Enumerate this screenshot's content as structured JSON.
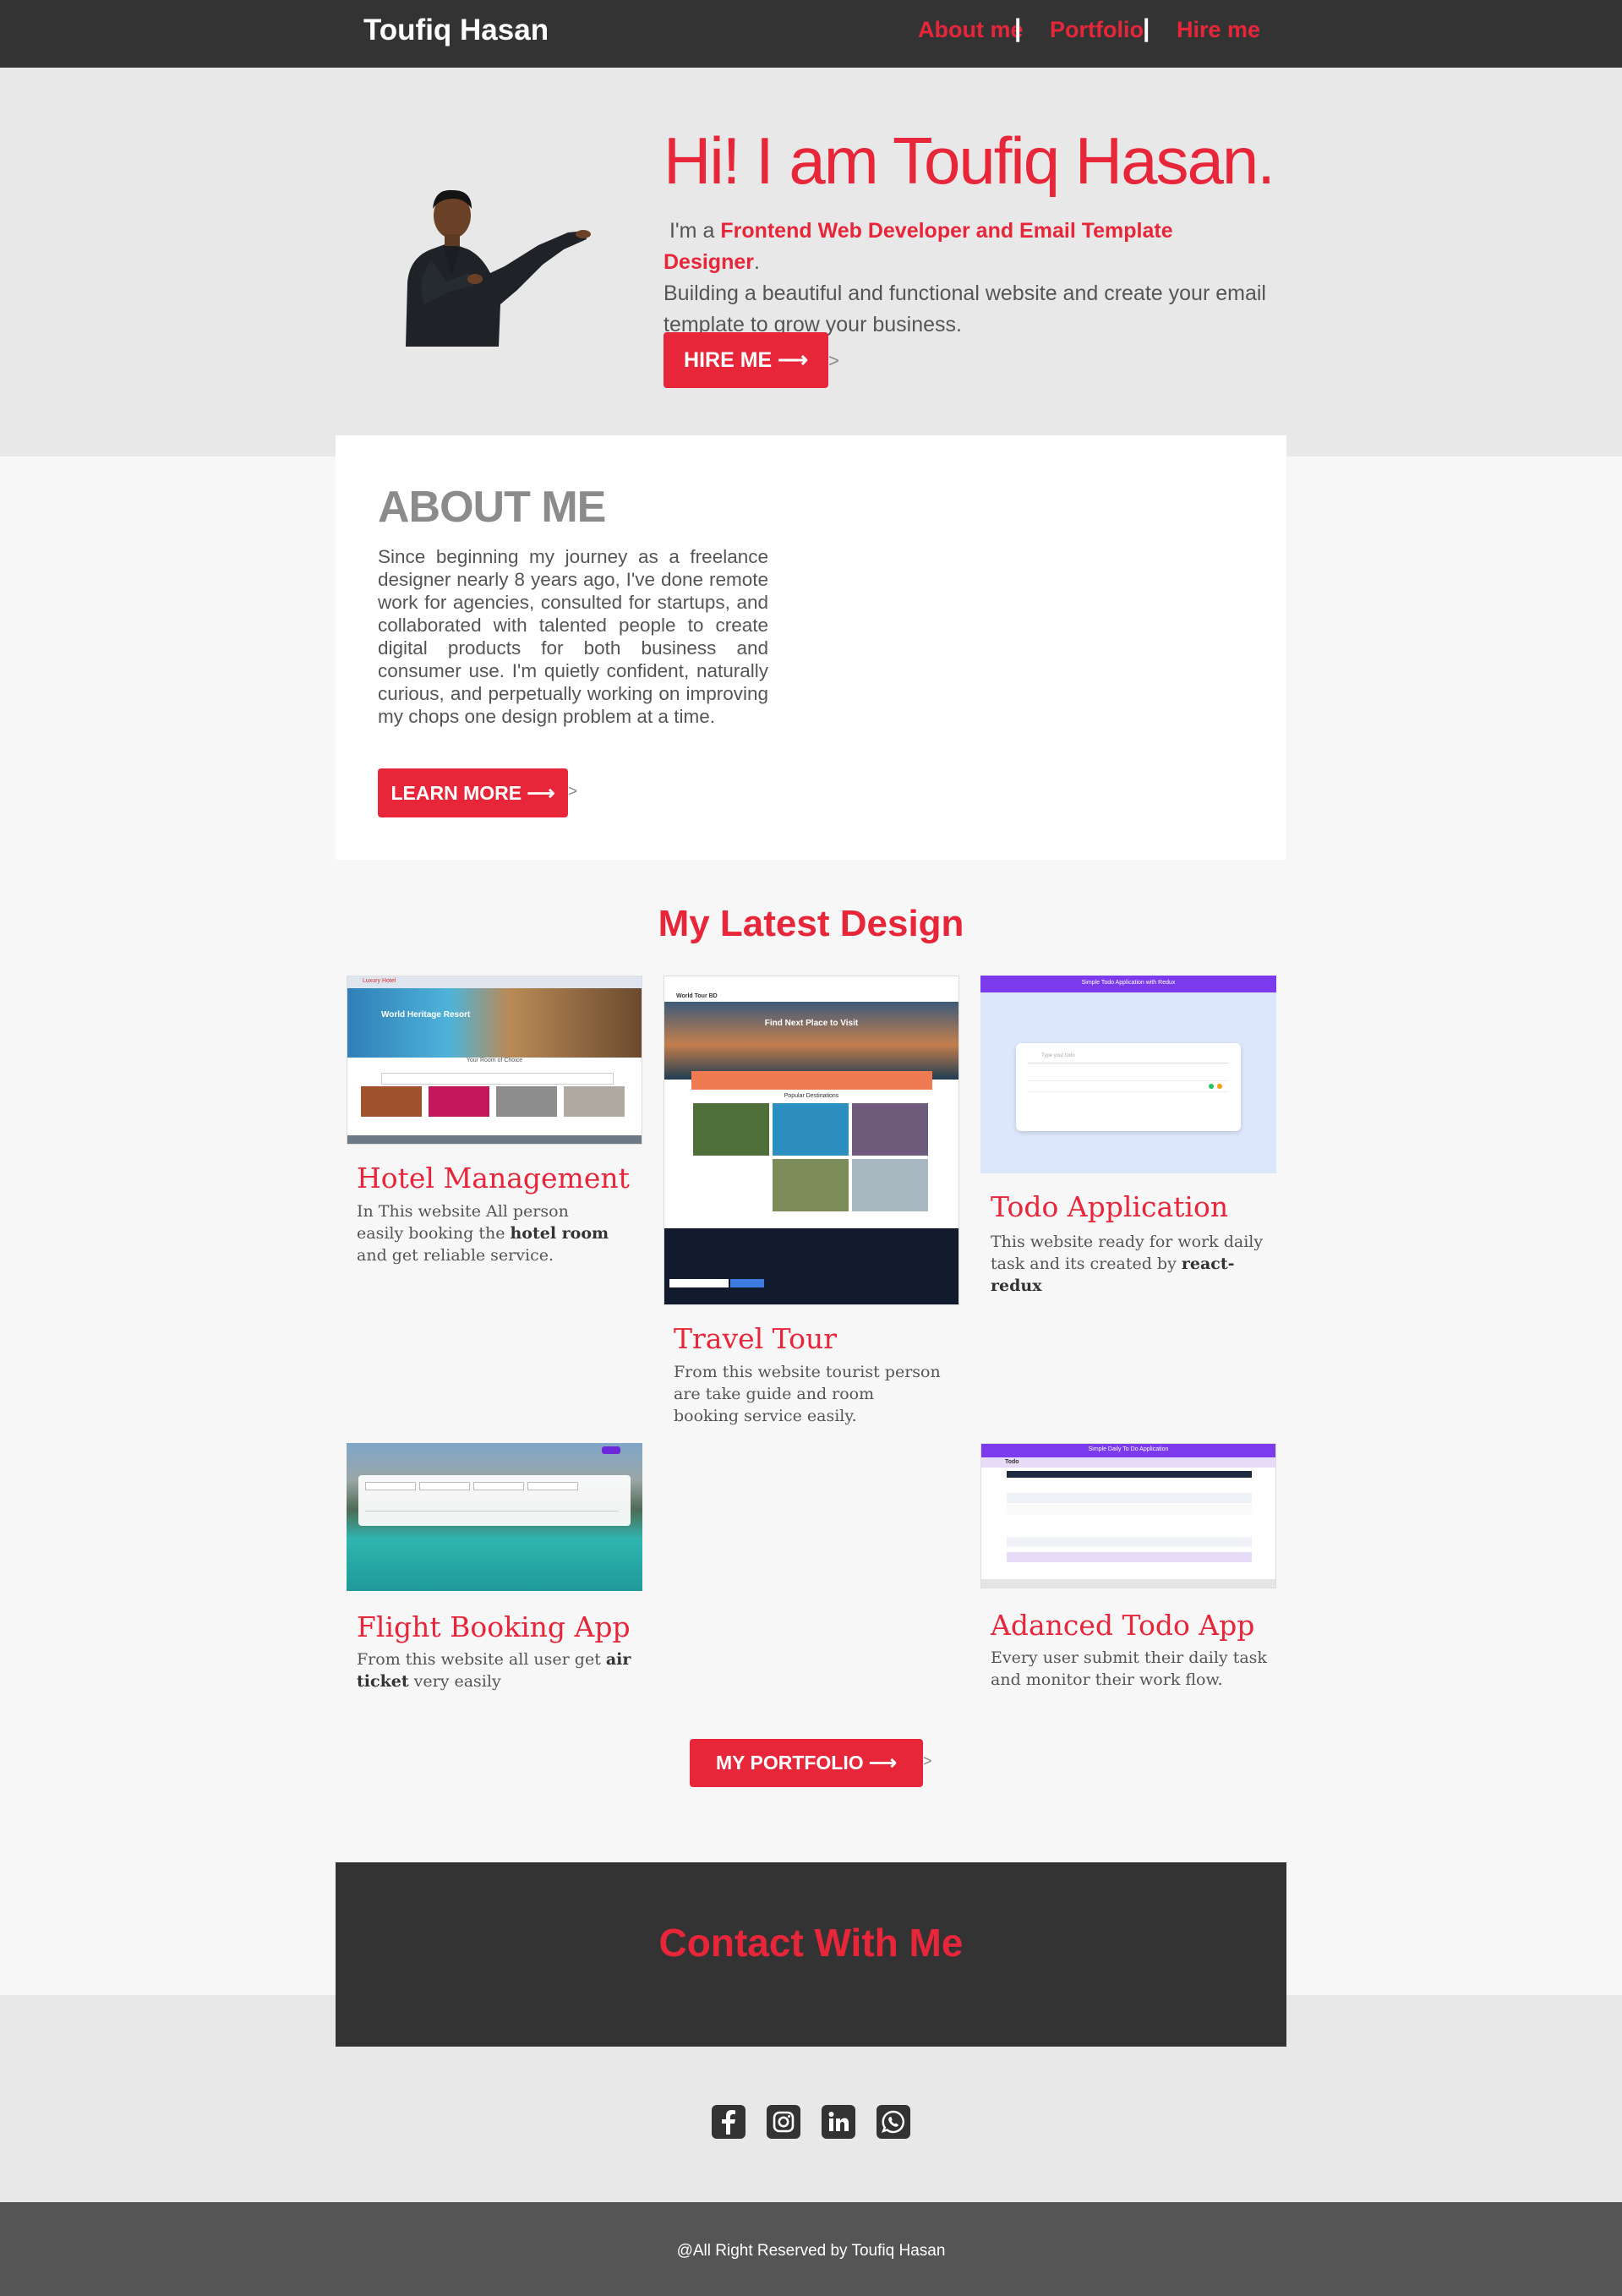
{
  "nav": {
    "brand": "Toufiq Hasan",
    "links": [
      "About me",
      "Portfolio",
      "Hire me"
    ],
    "separator": "|"
  },
  "hero": {
    "title": "Hi! I am Toufiq Hasan.",
    "intro_prefix": "I'm a",
    "intro_role": "Frontend  Web Developer and Email Template Designer",
    "intro_suffix": ".",
    "intro_rest": "Building a beautiful and functional website and create your email template to grow your business.",
    "button": "HIRE ME ⟶",
    "button_tail": ">"
  },
  "about": {
    "title": "ABOUT ME",
    "text": "Since beginning my journey as a freelance designer nearly 8 years ago, I've done remote work for agencies, consulted for startups, and collaborated with talented people to create digital products for both business and consumer use. I'm quietly confident, naturally curious, and perpetually working on improving my chops one design problem at a time.",
    "button": "LEARN MORE ⟶",
    "button_tail": ">"
  },
  "portfolio": {
    "title": "My Latest Design",
    "projects": [
      {
        "title": "Hotel Management",
        "desc_1": "In This website All person easily booking the ",
        "desc_bold": "hotel room",
        "desc_2": " and get reliable service.",
        "shot": {
          "brand": "Luxury Hotel",
          "hero": "World Heritage Resort",
          "section": "Your Room of Choice"
        }
      },
      {
        "title": "Travel Tour",
        "desc_1": "From this website tourist person are take guide and room booking service easily.",
        "desc_bold": "",
        "desc_2": "",
        "shot": {
          "brand": "World Tour BD",
          "hero": "Find Next Place to Visit",
          "section": "Popular Destinations"
        }
      },
      {
        "title": "Todo Application",
        "desc_1": "This website ready for work daily task and its created by ",
        "desc_bold": "react-redux",
        "desc_2": "",
        "shot": {
          "header": "Simple Todo Application with Redux",
          "placeholder": "Type your todo"
        }
      },
      {
        "title": "Flight Booking App",
        "desc_1": "From this website all user get ",
        "desc_bold": "air ticket",
        "desc_2": " very easily",
        "shot": {}
      },
      {
        "title": "Adanced Todo App",
        "desc_1": "Every user submit their daily task  and monitor their work flow.",
        "desc_bold": "",
        "desc_2": "",
        "shot": {
          "header": "Simple Daily To Do Application",
          "brand": "Todo"
        }
      }
    ],
    "button": "MY PORTFOLIO ⟶",
    "button_tail": ">"
  },
  "contact": {
    "title": "Contact With Me"
  },
  "social": {
    "icons": [
      "facebook-icon",
      "instagram-icon",
      "linkedin-icon",
      "whatsapp-icon"
    ]
  },
  "footer": {
    "text": "@All Right Reserved  by Toufiq Hasan"
  },
  "colors": {
    "accent": "#e8263a",
    "dark": "#333333",
    "footer": "#555555",
    "light": "#e8e8e8"
  }
}
